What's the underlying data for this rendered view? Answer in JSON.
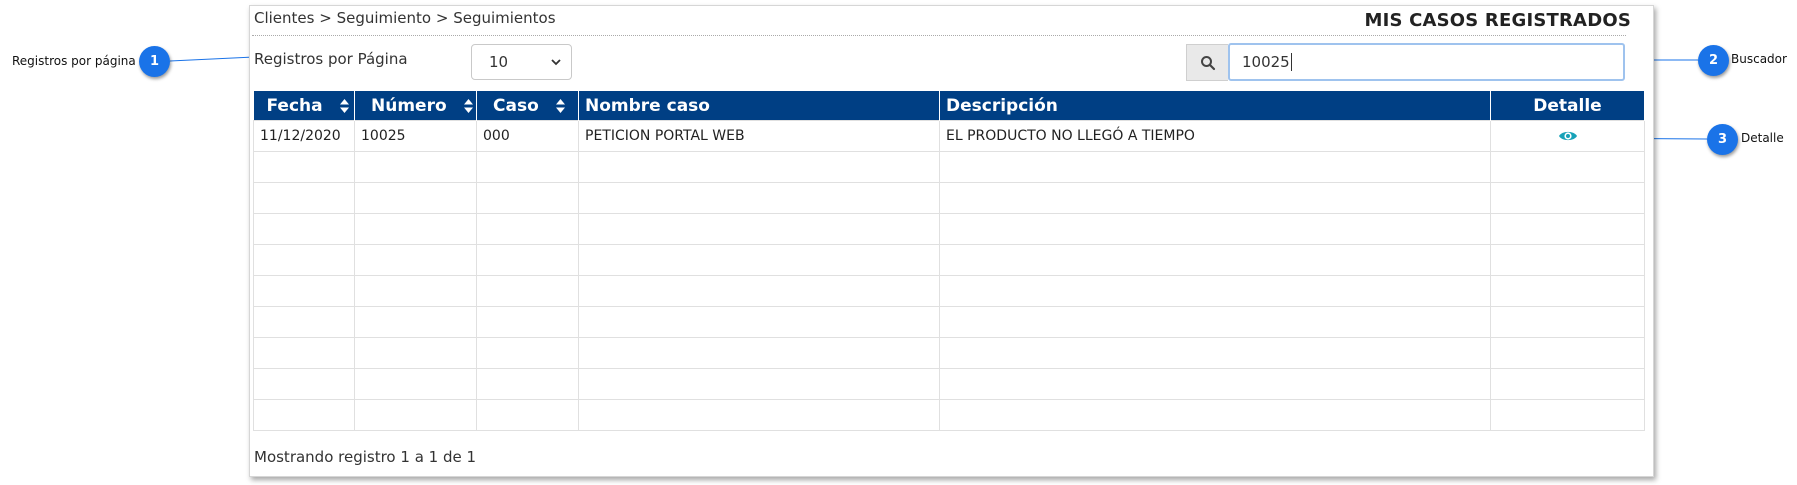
{
  "breadcrumb": "Clientes > Seguimiento > Seguimientos",
  "page_title": "MIS CASOS REGISTRADOS",
  "records_per_page": {
    "label": "Registros por Página",
    "selected": "10"
  },
  "search": {
    "value": "10025"
  },
  "table": {
    "columns": [
      {
        "label": "Fecha",
        "sortable": true
      },
      {
        "label": "Número",
        "sortable": true
      },
      {
        "label": "Caso",
        "sortable": true
      },
      {
        "label": "Nombre caso",
        "sortable": false
      },
      {
        "label": "Descripción",
        "sortable": false
      },
      {
        "label": "Detalle",
        "sortable": false
      }
    ],
    "rows": [
      {
        "fecha": "11/12/2020",
        "numero": "10025",
        "caso": "000",
        "nombre": "PETICION PORTAL WEB",
        "descripcion": "EL PRODUCTO NO LLEGÓ A TIEMPO",
        "detalle_icon": "eye-icon"
      }
    ],
    "empty_rows": 9
  },
  "footer": "Mostrando registro 1 a 1 de 1",
  "callouts": [
    {
      "number": "1",
      "label": "Registros por página"
    },
    {
      "number": "2",
      "label": "Buscador"
    },
    {
      "number": "3",
      "label": "Detalle"
    }
  ],
  "colors": {
    "header_bg": "#003f84",
    "callout": "#1a73e8",
    "eye_icon": "#17a2b8"
  }
}
